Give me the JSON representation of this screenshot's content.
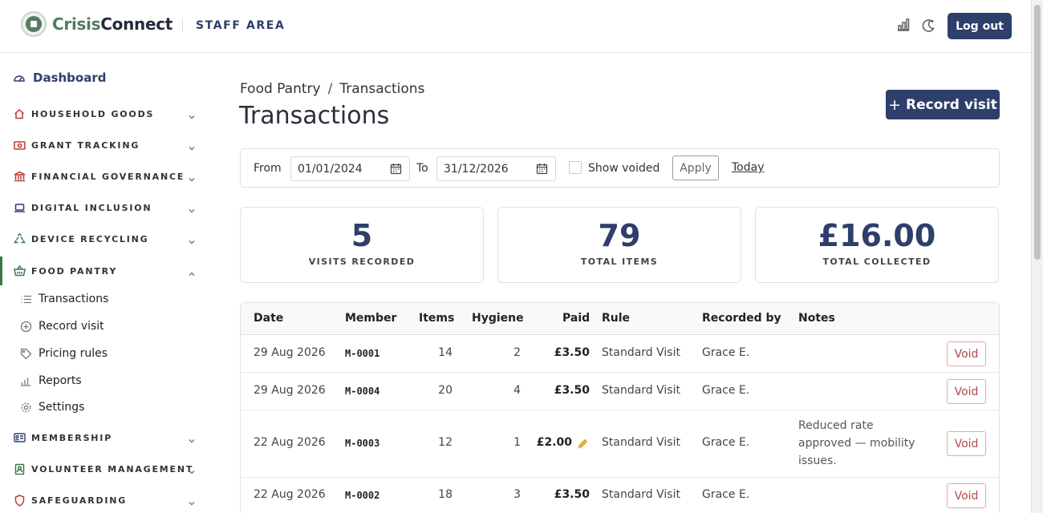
{
  "header": {
    "brand_part1": "Crisis",
    "brand_part2": "Connect",
    "section": "STAFF AREA",
    "logout_label": "Log out",
    "icons": [
      "chart-icon",
      "theme-toggle-icon"
    ]
  },
  "sidebar": {
    "dashboard_label": "Dashboard",
    "groups": [
      {
        "label": "Household Goods",
        "icon": "home-icon"
      },
      {
        "label": "Grant Tracking",
        "icon": "money-icon"
      },
      {
        "label": "Financial Governance",
        "icon": "bank-icon"
      },
      {
        "label": "Digital Inclusion",
        "icon": "laptop-icon"
      },
      {
        "label": "Device Recycling",
        "icon": "recycle-icon"
      },
      {
        "label": "Food Pantry",
        "icon": "basket-icon"
      },
      {
        "label": "Membership",
        "icon": "id-card-icon"
      },
      {
        "label": "Volunteer Management",
        "icon": "badge-icon"
      },
      {
        "label": "Safeguarding",
        "icon": "shield-icon"
      }
    ],
    "food_pantry_items": [
      {
        "label": "Transactions",
        "icon": "list-icon"
      },
      {
        "label": "Record visit",
        "icon": "plus-circle-icon"
      },
      {
        "label": "Pricing rules",
        "icon": "tag-icon"
      },
      {
        "label": "Reports",
        "icon": "bar-chart-icon"
      },
      {
        "label": "Settings",
        "icon": "gear-icon"
      }
    ]
  },
  "main": {
    "breadcrumb": {
      "parent": "Food Pantry",
      "separator": "/",
      "current": "Transactions"
    },
    "title": "Transactions",
    "record_visit_label": "Record visit",
    "filters": {
      "from_label": "From",
      "from_value": "01/01/2024",
      "to_label": "To",
      "to_value": "31/12/2026",
      "show_voided_label": "Show voided",
      "show_voided_checked": false,
      "apply_label": "Apply",
      "today_label": "Today"
    },
    "stats": [
      {
        "value": "5",
        "label": "Visits recorded"
      },
      {
        "value": "79",
        "label": "Total items"
      },
      {
        "value": "£16.00",
        "label": "Total collected"
      }
    ],
    "table": {
      "columns": [
        "Date",
        "Member",
        "Items",
        "Hygiene",
        "Paid",
        "Rule",
        "Recorded by",
        "Notes"
      ],
      "void_label": "Void",
      "rows": [
        {
          "date": "29 Aug 2026",
          "member": "M-0001",
          "items": "14",
          "hygiene": "2",
          "paid": "£3.50",
          "rule": "Standard Visit",
          "recorded_by": "Grace E.",
          "notes": "",
          "edited": false
        },
        {
          "date": "29 Aug 2026",
          "member": "M-0004",
          "items": "20",
          "hygiene": "4",
          "paid": "£3.50",
          "rule": "Standard Visit",
          "recorded_by": "Grace E.",
          "notes": "",
          "edited": false
        },
        {
          "date": "22 Aug 2026",
          "member": "M-0003",
          "items": "12",
          "hygiene": "1",
          "paid": "£2.00",
          "rule": "Standard Visit",
          "recorded_by": "Grace E.",
          "notes": "Reduced rate approved — mobility issues.",
          "edited": true
        },
        {
          "date": "22 Aug 2026",
          "member": "M-0002",
          "items": "18",
          "hygiene": "3",
          "paid": "£3.50",
          "rule": "Standard Visit",
          "recorded_by": "Grace E.",
          "notes": "",
          "edited": false
        }
      ]
    }
  }
}
